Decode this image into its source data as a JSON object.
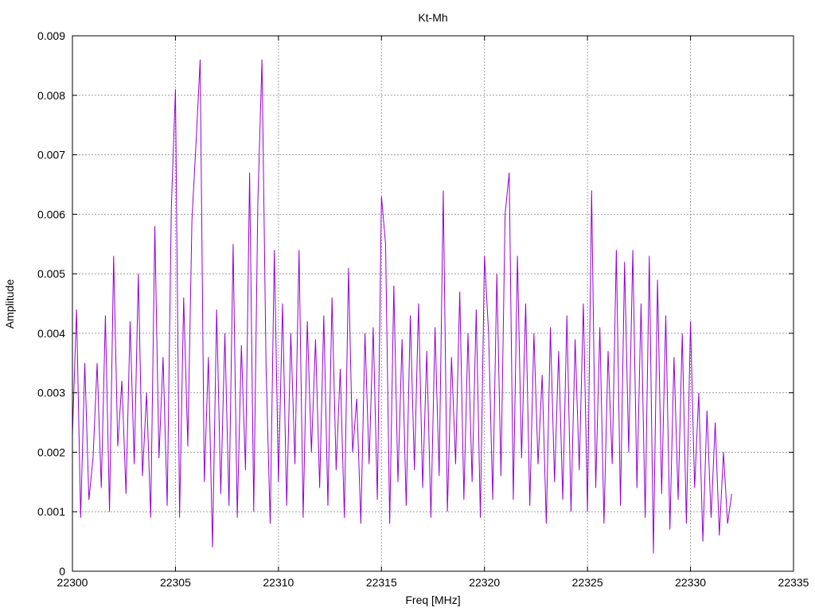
{
  "chart_data": {
    "type": "line",
    "title": "Kt-Mh",
    "xlabel": "Freq [MHz]",
    "ylabel": "Amplitude",
    "xlim": [
      22300,
      22335
    ],
    "ylim": [
      0,
      0.009
    ],
    "grid": true,
    "legend": "none",
    "x_ticks": [
      "22300",
      "22305",
      "22310",
      "22315",
      "22320",
      "22325",
      "22330",
      "22335"
    ],
    "y_ticks": [
      "0",
      "0.001",
      "0.002",
      "0.003",
      "0.004",
      "0.005",
      "0.006",
      "0.007",
      "0.008",
      "0.009"
    ],
    "series": [
      {
        "name": "Amplitude",
        "color": "#9400d3",
        "x_start": 22300,
        "x_step": 0.2,
        "values": [
          0.0023,
          0.0044,
          0.0009,
          0.0035,
          0.0012,
          0.0019,
          0.0035,
          0.0014,
          0.0043,
          0.001,
          0.0053,
          0.0021,
          0.0032,
          0.0013,
          0.0042,
          0.0018,
          0.005,
          0.0016,
          0.003,
          0.0009,
          0.0058,
          0.0019,
          0.0036,
          0.0011,
          0.0061,
          0.0081,
          0.0009,
          0.0046,
          0.0021,
          0.0059,
          0.0072,
          0.0086,
          0.0015,
          0.0036,
          0.0004,
          0.0044,
          0.0013,
          0.004,
          0.0011,
          0.0055,
          0.0009,
          0.0038,
          0.0017,
          0.0067,
          0.001,
          0.0062,
          0.0086,
          0.0034,
          0.0008,
          0.0054,
          0.0015,
          0.0045,
          0.0011,
          0.004,
          0.0018,
          0.0054,
          0.0009,
          0.0042,
          0.002,
          0.0039,
          0.0014,
          0.0043,
          0.0011,
          0.0046,
          0.0017,
          0.0034,
          0.0009,
          0.0051,
          0.002,
          0.0029,
          0.0008,
          0.004,
          0.0018,
          0.0041,
          0.0012,
          0.0063,
          0.0055,
          0.0008,
          0.0048,
          0.0015,
          0.0039,
          0.0011,
          0.0043,
          0.0017,
          0.0045,
          0.0014,
          0.0037,
          0.0009,
          0.0041,
          0.0016,
          0.0064,
          0.001,
          0.0036,
          0.0018,
          0.0047,
          0.0012,
          0.004,
          0.0015,
          0.0044,
          0.0009,
          0.0053,
          0.004,
          0.0012,
          0.005,
          0.0016,
          0.006,
          0.0067,
          0.0012,
          0.0053,
          0.0019,
          0.0045,
          0.0011,
          0.004,
          0.0018,
          0.0033,
          0.0008,
          0.0041,
          0.0015,
          0.0037,
          0.0012,
          0.0043,
          0.001,
          0.0039,
          0.0017,
          0.0045,
          0.001,
          0.0064,
          0.0014,
          0.0041,
          0.0008,
          0.0037,
          0.0018,
          0.0054,
          0.0011,
          0.0052,
          0.002,
          0.0054,
          0.0014,
          0.0045,
          0.0009,
          0.0053,
          0.0003,
          0.0049,
          0.0013,
          0.0043,
          0.0007,
          0.0036,
          0.0012,
          0.004,
          0.0008,
          0.0042,
          0.0014,
          0.003,
          0.0005,
          0.0027,
          0.0009,
          0.0025,
          0.0006,
          0.002,
          0.0008,
          0.0013
        ]
      }
    ]
  }
}
